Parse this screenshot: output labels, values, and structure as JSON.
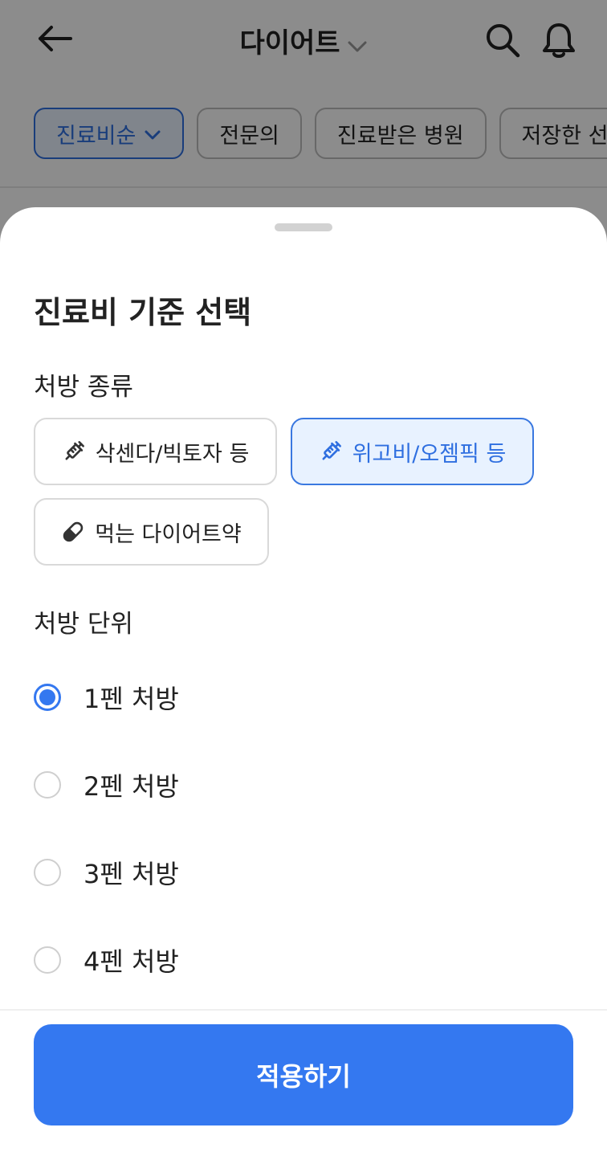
{
  "header": {
    "title": "다이어트"
  },
  "filters": [
    {
      "label": "진료비순",
      "active": true
    },
    {
      "label": "전문의",
      "active": false
    },
    {
      "label": "진료받은 병원",
      "active": false
    },
    {
      "label": "저장한 선",
      "active": false
    }
  ],
  "sheet": {
    "title": "진료비 기준 선택",
    "prescription_type": {
      "label": "처방 종류",
      "options": [
        {
          "label": "삭센다/빅토자 등",
          "icon": "syringe-icon",
          "selected": false
        },
        {
          "label": "위고비/오젬픽 등",
          "icon": "syringe-icon",
          "selected": true
        },
        {
          "label": "먹는 다이어트약",
          "icon": "pill-icon",
          "selected": false
        }
      ]
    },
    "prescription_unit": {
      "label": "처방 단위",
      "options": [
        {
          "label": "1펜 처방",
          "checked": true
        },
        {
          "label": "2펜 처방",
          "checked": false
        },
        {
          "label": "3펜 처방",
          "checked": false
        },
        {
          "label": "4펜 처방",
          "checked": false
        }
      ]
    },
    "apply_label": "적용하기"
  },
  "colors": {
    "accent": "#3478f0",
    "selected_bg": "#e8f2ff"
  }
}
